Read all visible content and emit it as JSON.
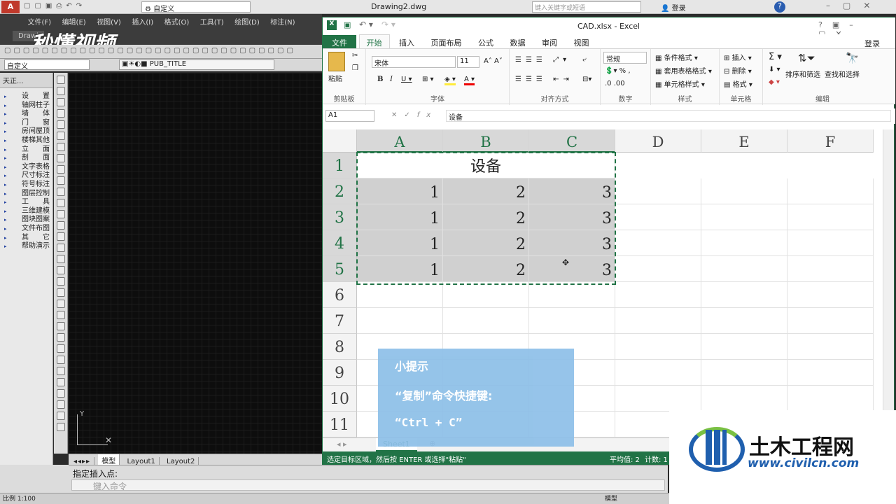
{
  "cad": {
    "title": "Drawing2.dwg",
    "workspace": "自定义",
    "search_placeholder": "键入关键字或短语",
    "login": "登录",
    "menu": [
      "文件(F)",
      "编辑(E)",
      "视图(V)",
      "插入(I)",
      "格式(O)",
      "工具(T)",
      "绘图(D)",
      "标注(N)"
    ],
    "doc_tab": "Drawi",
    "style_select": "自定义",
    "layer_name": "PUB_TITLE",
    "panel_title": "天正...",
    "panel_items": [
      "设　　置",
      "轴网柱子",
      "墙　　体",
      "门　　窗",
      "房间屋顶",
      "楼梯其他",
      "立　　面",
      "剖　　面",
      "文字表格",
      "尺寸标注",
      "符号标注",
      "图层控制",
      "工　　具",
      "三维建模",
      "图块图案",
      "文件布图",
      "其　　它",
      "帮助演示"
    ],
    "layout_tabs": [
      "模型",
      "Layout1",
      "Layout2"
    ],
    "command_line": "指定插入点:",
    "command_placeholder": "键入命令",
    "status_scale": "比例 1:100",
    "status_model": "模型"
  },
  "excel": {
    "title": "CAD.xlsx - Excel",
    "login": "登录",
    "tabs": [
      "文件",
      "开始",
      "插入",
      "页面布局",
      "公式",
      "数据",
      "审阅",
      "视图"
    ],
    "active_tab": "开始",
    "ribbon": {
      "paste": "粘贴",
      "clipboard": "剪贴板",
      "font_name": "宋体",
      "font_size": "11",
      "font_group": "字体",
      "align_group": "对齐方式",
      "number_format": "常规",
      "number_group": "数字",
      "cond_format": "条件格式",
      "table_format": "套用表格格式",
      "cell_style": "单元格样式",
      "styles_group": "样式",
      "insert": "插入",
      "delete": "删除",
      "format": "格式",
      "cells_group": "单元格",
      "sort_filter": "排序和筛选",
      "find_select": "查找和选择",
      "editing_group": "编辑"
    },
    "name_box": "A1",
    "formula": "设备",
    "columns": [
      "A",
      "B",
      "C",
      "D",
      "E",
      "F"
    ],
    "rows": [
      "1",
      "2",
      "3",
      "4",
      "5",
      "6",
      "7",
      "8",
      "9",
      "10",
      "11"
    ],
    "header_cell": "设备",
    "data": [
      [
        "1",
        "2",
        "3"
      ],
      [
        "1",
        "2",
        "3"
      ],
      [
        "1",
        "2",
        "3"
      ],
      [
        "1",
        "2",
        "3"
      ]
    ],
    "sheet": "Sheet1",
    "status_left": "选定目标区域，然后按 ENTER 或选择\"粘贴\"",
    "status_avg": "平均值: 2",
    "status_count": "计数: 1"
  },
  "tip": {
    "title": "小提示",
    "line1": "“复制”命令快捷键:",
    "line2": "“Ctrl + C”"
  },
  "watermark": {
    "brand": "土木工程网",
    "url": "www.civilcn.com",
    "overlay": "秒懂视频"
  }
}
